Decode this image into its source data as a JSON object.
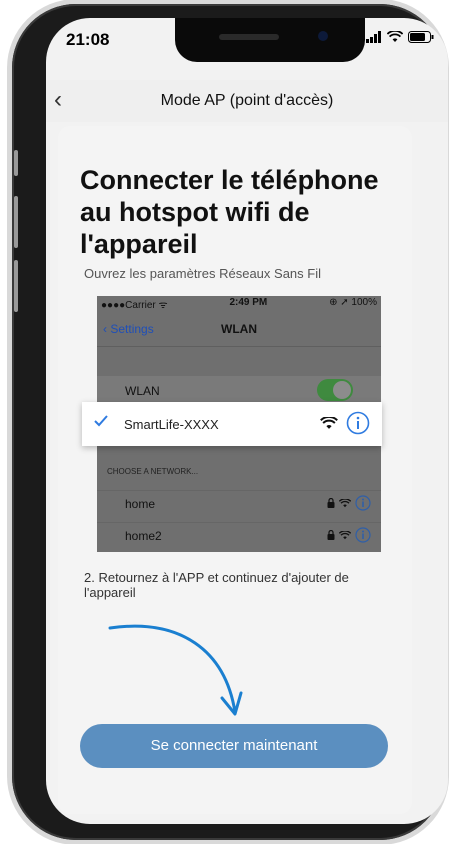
{
  "status": {
    "time": "21:08"
  },
  "nav": {
    "title": "Mode AP (point d'accès)"
  },
  "content": {
    "heading": "Connecter le téléphone au hotspot wifi de l'appareil",
    "step1": "Ouvrez les paramètres Réseaux Sans Fil",
    "step2": "2. Retournez à l'APP et continuez d'ajouter de l'appareil"
  },
  "screenshot": {
    "status_left": "●●●●Carrier ᯤ",
    "status_time": "2:49 PM",
    "status_right": "⊕ ➚ 100%",
    "back_label": "Settings",
    "title": "WLAN",
    "wlan_label": "WLAN",
    "selected_network": "SmartLife-XXXX",
    "choose_label": "CHOOSE A NETWORK...",
    "networks": [
      "home",
      "home2"
    ]
  },
  "cta": {
    "label": "Se connecter maintenant"
  },
  "colors": {
    "accent": "#5b8fc0",
    "info_blue": "#2f7be0"
  }
}
